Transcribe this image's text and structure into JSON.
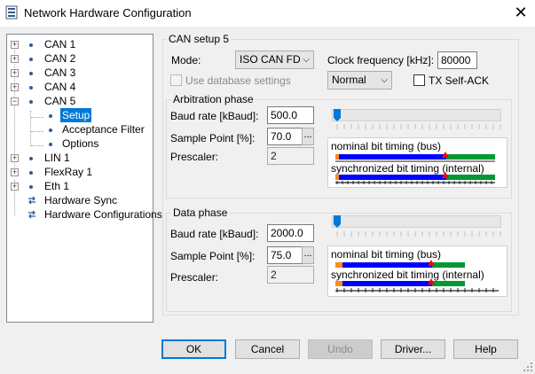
{
  "window": {
    "title": "Network Hardware Configuration"
  },
  "tree": {
    "items": [
      {
        "label": "CAN 1"
      },
      {
        "label": "CAN 2"
      },
      {
        "label": "CAN 3"
      },
      {
        "label": "CAN 4"
      },
      {
        "label": "CAN 5"
      },
      {
        "label": "Setup"
      },
      {
        "label": "Acceptance Filter"
      },
      {
        "label": "Options"
      },
      {
        "label": "LIN 1"
      },
      {
        "label": "FlexRay 1"
      },
      {
        "label": "Eth 1"
      },
      {
        "label": "Hardware Sync"
      },
      {
        "label": "Hardware Configurations"
      }
    ]
  },
  "setup": {
    "group_title": "CAN setup 5",
    "mode_label": "Mode:",
    "mode_value": "ISO CAN FD",
    "clock_label": "Clock frequency [kHz]:",
    "clock_value": "80000",
    "use_db_label": "Use database settings",
    "output_mode_value": "Normal",
    "tx_self_ack_label": "TX Self-ACK"
  },
  "arbitration": {
    "title": "Arbitration phase",
    "baud_label": "Baud rate [kBaud]:",
    "baud_value": "500.0",
    "sample_label": "Sample Point [%]:",
    "sample_value": "70.0",
    "prescaler_label": "Prescaler:",
    "prescaler_value": "2",
    "nominal_label": "nominal bit timing (bus)",
    "sync_label": "synchronized bit timing (internal)",
    "slider_level": 0.0
  },
  "data_phase": {
    "title": "Data phase",
    "baud_label": "Baud rate [kBaud]:",
    "baud_value": "2000.0",
    "sample_label": "Sample Point [%]:",
    "sample_value": "75.0",
    "prescaler_label": "Prescaler:",
    "prescaler_value": "2",
    "nominal_label": "nominal bit timing (bus)",
    "sync_label": "synchronized bit timing (internal)",
    "slider_level": 0.0
  },
  "buttons": {
    "ok": "OK",
    "cancel": "Cancel",
    "undo": "Undo",
    "driver": "Driver...",
    "help": "Help",
    "dots": "..."
  },
  "colors": {
    "selection": "#0078d7",
    "timing_blue": "#0000ff",
    "timing_green": "#009933",
    "timing_orange": "#ff8c1a",
    "sample_marker": "#ff0000"
  }
}
